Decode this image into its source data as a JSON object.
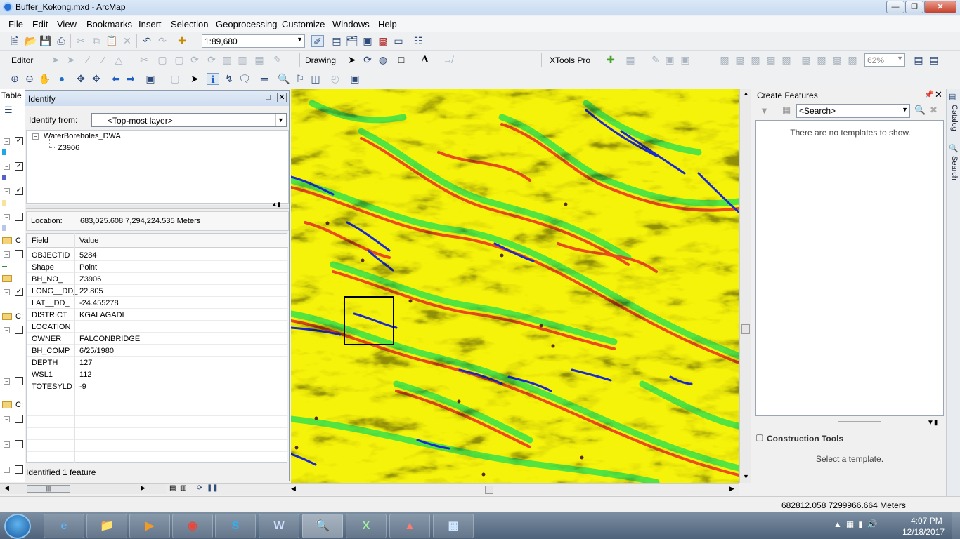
{
  "window": {
    "title": "Buffer_Kokong.mxd - ArcMap"
  },
  "menubar": [
    "File",
    "Edit",
    "View",
    "Bookmarks",
    "Insert",
    "Selection",
    "Geoprocessing",
    "Customize",
    "Windows",
    "Help"
  ],
  "toolbar": {
    "scale": "1:89,680",
    "editor_label": "Editor",
    "drawing_label": "Drawing",
    "xtools_label": "XTools Pro",
    "zoom_percent": "62%",
    "font_glyph": "A"
  },
  "toc": {
    "title": "Table",
    "group_labels": [
      "C:",
      "C:",
      "C:"
    ]
  },
  "identify": {
    "title": "Identify",
    "identify_from_label": "Identify from:",
    "identify_from_value": "<Top-most layer>",
    "layer_name": "WaterBoreholes_DWA",
    "feature_name": "Z3906",
    "location_label": "Location:",
    "location_value": "683,025.608  7,294,224.535 Meters",
    "col_field": "Field",
    "col_value": "Value",
    "rows": [
      {
        "field": "OBJECTID",
        "value": "5284"
      },
      {
        "field": "Shape",
        "value": "Point"
      },
      {
        "field": "BH_NO_",
        "value": "Z3906"
      },
      {
        "field": "LONG__DD_",
        "value": "22.805"
      },
      {
        "field": "LAT__DD_",
        "value": "-24.455278"
      },
      {
        "field": "DISTRICT",
        "value": "KGALAGADI"
      },
      {
        "field": "LOCATION",
        "value": ""
      },
      {
        "field": "OWNER",
        "value": "FALCONBRIDGE"
      },
      {
        "field": "BH_COMP",
        "value": "6/25/1980"
      },
      {
        "field": "DEPTH",
        "value": "127"
      },
      {
        "field": "WSL1",
        "value": "112"
      },
      {
        "field": "TOTESYLD",
        "value": "-9"
      }
    ],
    "status": "Identified 1 feature"
  },
  "create_features": {
    "title": "Create Features",
    "search_placeholder": "<Search>",
    "empty_message": "There are no templates to show."
  },
  "construction_tools": {
    "title": "Construction Tools",
    "message": "Select a template."
  },
  "side_tabs": [
    "Catalog",
    "Search"
  ],
  "statusbar": {
    "coords": "682812.058  7299966.664 Meters"
  },
  "taskbar": {
    "apps": [
      "internet-explorer",
      "file-explorer",
      "media-player",
      "chrome",
      "skype",
      "word",
      "arcmap",
      "excel",
      "acrobat",
      "control-panel"
    ],
    "time": "4:07 PM",
    "date": "12/18/2017"
  },
  "colors": {
    "map_background": "#f6f30a",
    "map_green": "#38e24a",
    "map_red": "#ea3b1f",
    "map_blue": "#1a2ad0"
  }
}
